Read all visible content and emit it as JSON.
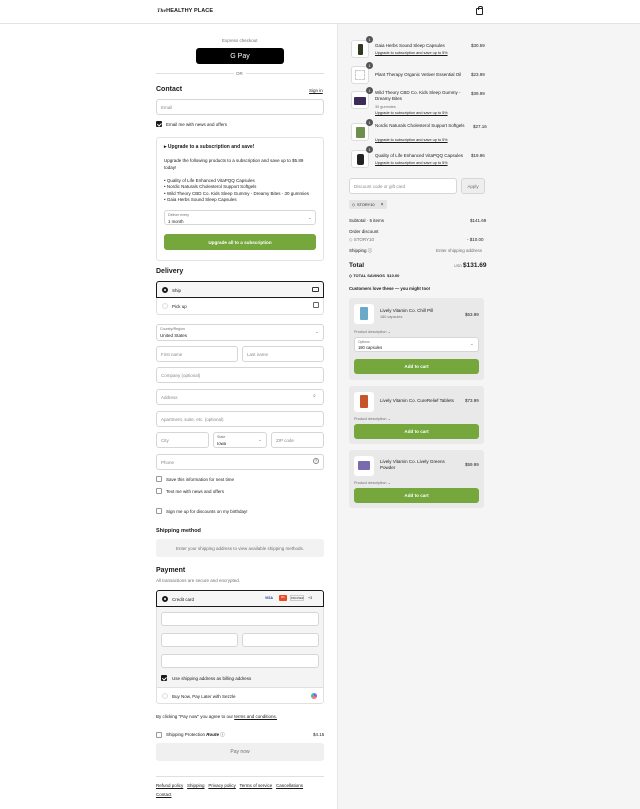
{
  "brand": {
    "logo_prefix": "The",
    "logo_main": "HEALTHY PLACE"
  },
  "express": {
    "label": "Express checkout",
    "gpay": "G Pay",
    "or": "OR"
  },
  "contact": {
    "heading": "Contact",
    "signin": "Sign in",
    "email_placeholder": "Email",
    "email_news": "Email me with news and offers"
  },
  "subscription": {
    "title": "Upgrade to a subscription and save!",
    "desc": "Upgrade the following products to a subscription and save up to $5.89 today!",
    "items": [
      "Quality of Life Enhanced VitaPQQ Capsules",
      "Nordic Naturals Cholesterol Support Softgels",
      "Wild Theory CBD Co. Kids Sleep Gummy - Dreamy Bites - 30 gummies",
      "Gaia Herbs Sound Sleep Capsules"
    ],
    "delivery_label": "Deliver every",
    "delivery_value": "1 month",
    "button": "Upgrade all to a subscription"
  },
  "delivery": {
    "heading": "Delivery",
    "ship": "Ship",
    "pickup": "Pick up",
    "country_label": "Country/Region",
    "country_value": "United States",
    "first": "First name",
    "last": "Last name",
    "company": "Company (optional)",
    "address": "Address",
    "apt": "Apartment, suite, etc. (optional)",
    "city": "City",
    "state_label": "State",
    "state_value": "Iowa",
    "zip": "ZIP code",
    "phone": "Phone",
    "save_info": "Save this information for next time",
    "text_me": "Text me with news and offers",
    "birthday": "Sign me up for discounts on my birthday!"
  },
  "shipping_method": {
    "heading": "Shipping method",
    "notice": "Enter your shipping address to view available shipping methods."
  },
  "payment": {
    "heading": "Payment",
    "sub": "All transactions are secure and encrypted.",
    "credit": "Credit card",
    "cards": [
      "VISA",
      "MC",
      "DISCOVER",
      "+3"
    ],
    "billing": "Use shipping address as billing address",
    "sezzle": "Buy Now, Pay Later with Sezzle"
  },
  "agree": {
    "prefix": "By clicking \"Pay now\" you agree to our ",
    "terms": "terms and conditions."
  },
  "protection": {
    "label": "Shipping Protection",
    "brand": "Route",
    "price": "$4.15"
  },
  "pay_now": "Pay now",
  "footer": [
    "Refund policy",
    "Shipping",
    "Privacy policy",
    "Terms of service",
    "Cancellations",
    "Contact"
  ],
  "cart": {
    "items": [
      {
        "qty": "1",
        "name": "Gaia Herbs Sound Sleep Capsules",
        "sub": "",
        "upgrade": "Upgrade to subscription and save up to 5%",
        "price": "$30.59",
        "color": "#2f3a1d"
      },
      {
        "qty": "1",
        "name": "Plant Therapy Organic Vetiver Essential Oil",
        "sub": "",
        "upgrade": "",
        "price": "$23.99",
        "color": "#e9e9e9"
      },
      {
        "qty": "1",
        "name": "Wild Theory CBD Co. Kids Sleep Gummy - Dreamy Bites",
        "sub": "30 gummies",
        "upgrade": "Upgrade to subscription and save up to 5%",
        "price": "$39.99",
        "color": "#3b2a5a"
      },
      {
        "qty": "1",
        "name": "Nordic Naturals Cholesterol Support Softgels",
        "sub": "",
        "upgrade": "Upgrade to subscription and save up to 5%",
        "price": "$27.16",
        "color": "#6f8f4f"
      },
      {
        "qty": "1",
        "name": "Quality of Life Enhanced VitaPQQ Capsules",
        "sub": "",
        "upgrade": "Upgrade to subscription and save up to 5%",
        "price": "$19.96",
        "color": "#222"
      }
    ],
    "discount_placeholder": "Discount code or gift card",
    "apply": "Apply",
    "code": "STORY10",
    "subtotal_label": "Subtotal · 5 items",
    "subtotal": "$141.69",
    "order_discount": "Order discount",
    "code_line": "STORY10",
    "discount_amt": "- $10.00",
    "shipping_label": "Shipping",
    "shipping_value": "Enter shipping address",
    "total_label": "Total",
    "currency": "USD",
    "total": "$131.69",
    "savings_label": "TOTAL SAVINGS",
    "savings": "$10.00"
  },
  "upsell": {
    "heading": "Customers love these — you might too!",
    "products": [
      {
        "name": "Lively Vitamin Co. Chill Pill",
        "sub": "180 capsules",
        "price": "$63.99",
        "desc": "Product description",
        "option_label": "Options",
        "option_value": "180 capsules",
        "button": "Add to cart"
      },
      {
        "name": "Lively Vitamin Co. CureRelief Tablets",
        "sub": "",
        "price": "$73.99",
        "desc": "Product description",
        "button": "Add to cart"
      },
      {
        "name": "Lively Vitamin Co. Lively Greens Powder",
        "sub": "",
        "price": "$59.99",
        "desc": "Product description",
        "button": "Add to cart"
      }
    ]
  }
}
